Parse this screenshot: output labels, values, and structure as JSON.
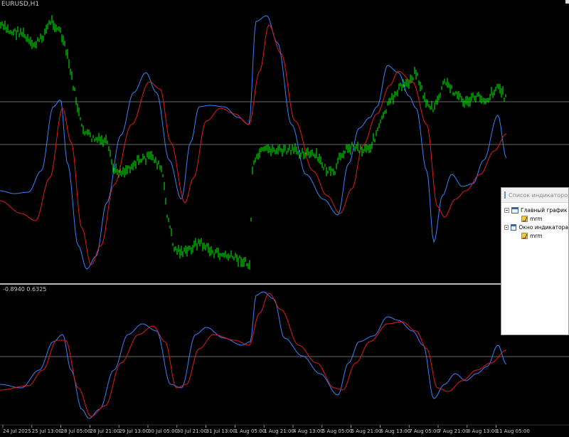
{
  "chart": {
    "title": "EURUSD,H1",
    "subwindow_values": "-0.8940 0.6325",
    "x_labels": [
      "24 Jul 2025",
      "25 Jul 13:00",
      "28 Jul 05:00",
      "28 Jul 21:00",
      "29 Jul 13:00",
      "30 Jul 05:00",
      "30 Jul 21:00",
      "31 Jul 13:00",
      "1 Aug 05:00",
      "1 Aug 21:00",
      "4 Aug 13:00",
      "5 Aug 05:00",
      "5 Aug 21:00",
      "6 Aug 13:00",
      "7 Aug 05:00",
      "7 Aug 21:00",
      "8 Aug 13:00",
      "11 Aug 05:00"
    ],
    "colors": {
      "background": "#000000",
      "candles": "#00ff00",
      "fast_line": "#3b7fff",
      "slow_line": "#e01b1b",
      "level_lines": "#8a8a8a",
      "separator": "#bbbbbb"
    }
  },
  "panel": {
    "title": "Список индикаторов к",
    "tree": [
      {
        "label": "Главный график",
        "children": [
          {
            "label": "mrm"
          }
        ]
      },
      {
        "label": "Окно индикатора",
        "children": [
          {
            "label": "mrm"
          }
        ]
      }
    ]
  }
}
